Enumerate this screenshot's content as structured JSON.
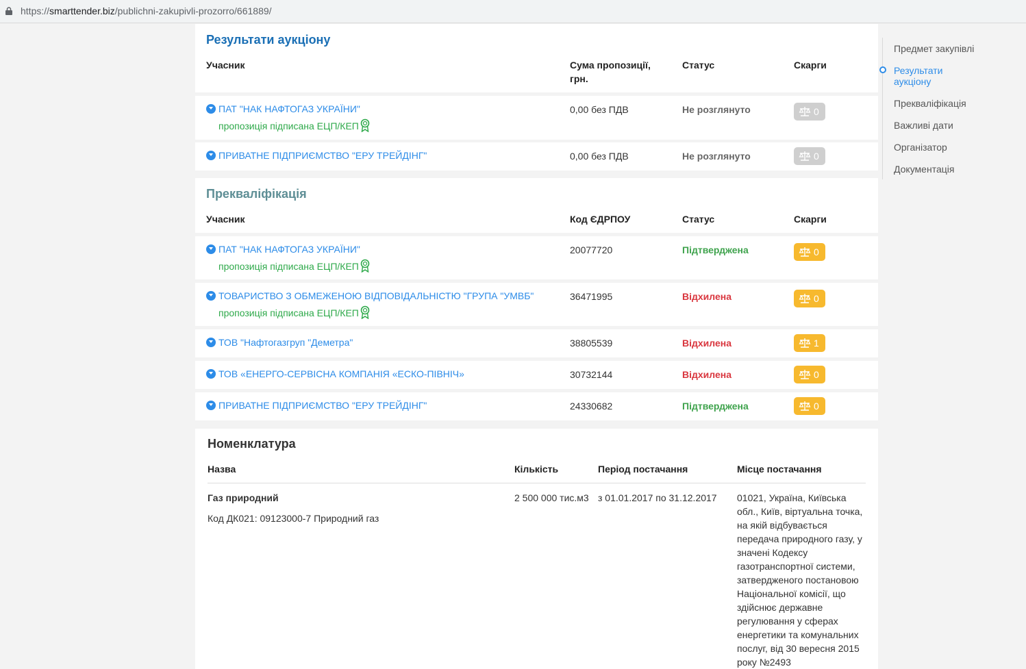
{
  "browser": {
    "url_scheme": "https://",
    "url_host": "smarttender.biz",
    "url_path": "/publichni-zakupivli-prozorro/661889/"
  },
  "auction": {
    "title": "Результати аукціону",
    "headers": {
      "participant": "Учасник",
      "sum_line1": "Сума пропозиції,",
      "sum_line2": "грн.",
      "status": "Статус",
      "complaints": "Скарги"
    },
    "rows": [
      {
        "name": "ПАТ \"НАК НАФТОГАЗ УКРАЇНИ\"",
        "signed": "пропозиція підписана ЕЦП/КЕП",
        "sum": "0,00 без ПДВ",
        "status": "Не розглянуто",
        "complaints": "0"
      },
      {
        "name": "ПРИВАТНЕ ПІДПРИЄМСТВО \"ЕРУ ТРЕЙДІНГ\"",
        "sum": "0,00 без ПДВ",
        "status": "Не розглянуто",
        "complaints": "0"
      }
    ]
  },
  "prequal": {
    "title": "Прекваліфікація",
    "headers": {
      "participant": "Учасник",
      "code": "Код ЄДРПОУ",
      "status": "Статус",
      "complaints": "Скарги"
    },
    "rows": [
      {
        "name": "ПАТ \"НАК НАФТОГАЗ УКРАЇНИ\"",
        "signed": "пропозиція підписана ЕЦП/КЕП",
        "code": "20077720",
        "status": "Підтверджена",
        "complaints": "0"
      },
      {
        "name": "ТОВАРИСТВО З ОБМЕЖЕНОЮ ВІДПОВІДАЛЬНІСТЮ \"ГРУПА \"УМВБ\"",
        "signed": "пропозиція підписана ЕЦП/КЕП",
        "code": "36471995",
        "status": "Відхилена",
        "complaints": "0"
      },
      {
        "name": "ТОВ \"Нафтогазгруп \"Деметра\"",
        "code": "38805539",
        "status": "Відхилена",
        "complaints": "1"
      },
      {
        "name": "ТОВ «ЕНЕРГО-СЕРВІСНА КОМПАНІЯ «ЕСКО-ПІВНІЧ»",
        "code": "30732144",
        "status": "Відхилена",
        "complaints": "0"
      },
      {
        "name": "ПРИВАТНЕ ПІДПРИЄМСТВО \"ЕРУ ТРЕЙДІНГ\"",
        "code": "24330682",
        "status": "Підтверджена",
        "complaints": "0"
      }
    ]
  },
  "nomenclature": {
    "title": "Номенклатура",
    "headers": {
      "name": "Назва",
      "qty": "Кількість",
      "period": "Період постачання",
      "place": "Місце постачання"
    },
    "item": {
      "name": "Газ природний",
      "code": "Код ДК021: 09123000-7 Природний газ",
      "qty": "2 500 000 тис.м3",
      "period": "з 01.01.2017 по 31.12.2017",
      "place_lines": [
        "01021, Україна, Київська",
        "обл., Київ, віртуальна точка,",
        "на якій відбувається",
        "передача природного газу, у",
        "значені Кодексу",
        "газотранспортної системи,",
        "затвердженого постановою",
        "Національної комісії, що",
        "здійснює державне",
        "регулювання у сферах",
        "енергетики та комунальних",
        "послуг, від 30 вересня 2015",
        "року №2493"
      ]
    }
  },
  "sidenav": {
    "items": [
      "Предмет закупівлі",
      "Результати",
      "аукціону",
      "Прекваліфікація",
      "Важливі дати",
      "Організатор",
      "Документація"
    ]
  },
  "colors": {
    "link": "#2d8ce8",
    "signed": "#2ea94a",
    "confirmed": "#3fa34d",
    "rejected": "#d9363e",
    "badge_yellow": "#f7b92e",
    "badge_grey": "#cfcfcf"
  },
  "icons": {
    "badge": "scales-icon",
    "signed": "medal-icon",
    "expand": "chevron-down-icon",
    "secure": "lock-icon"
  }
}
